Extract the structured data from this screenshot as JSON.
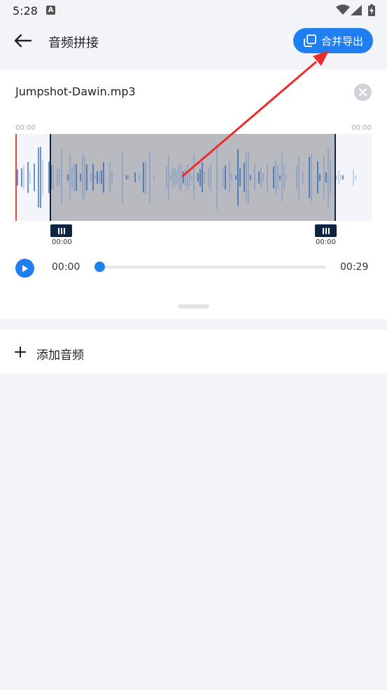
{
  "status_bar": {
    "time": "5:28",
    "notification_icon": "A"
  },
  "app_bar": {
    "title": "音频拼接",
    "export_label": "合并导出"
  },
  "audio_item": {
    "file_name": "Jumpshot-Dawin.mp3",
    "wave_start_time": "00:00",
    "wave_end_time": "00:00",
    "left_handle_time": "00:00",
    "right_handle_time": "00:00",
    "current_time": "00:00",
    "duration": "00:29",
    "progress": 0.0
  },
  "add_audio": {
    "label": "添加音频"
  },
  "colors": {
    "accent": "#1f7ef0",
    "handle": "#0f2440",
    "playhead": "#e8463b",
    "annotation_arrow": "#ee2b2b"
  },
  "icons": [
    "back-arrow-icon",
    "copy-export-icon",
    "close-icon",
    "play-icon",
    "plus-icon",
    "wifi-icon",
    "signal-icon",
    "battery-icon"
  ]
}
